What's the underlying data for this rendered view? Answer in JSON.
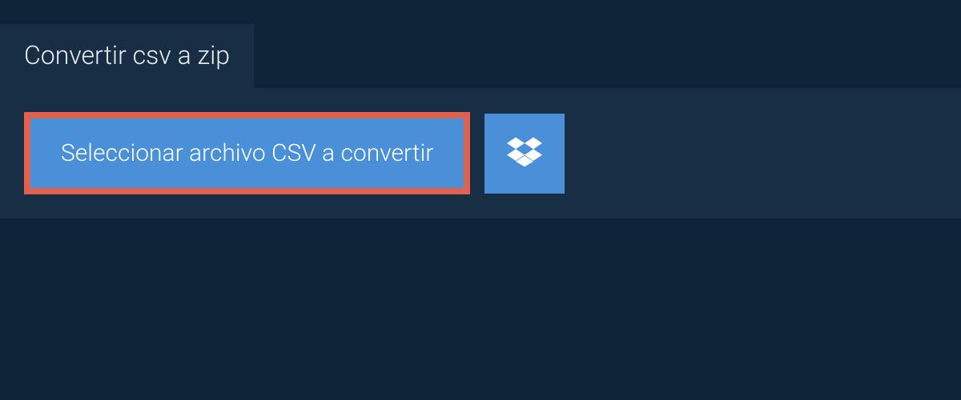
{
  "tab": {
    "title": "Convertir csv a zip"
  },
  "actions": {
    "select_label": "Seleccionar archivo CSV a convertir"
  },
  "colors": {
    "page_bg": "#0f2438",
    "panel_bg": "#172e44",
    "button_bg": "#4a90d9",
    "highlight_border": "#e0614f",
    "text_light": "#e7edf3",
    "text_on_button": "#ffffff"
  }
}
